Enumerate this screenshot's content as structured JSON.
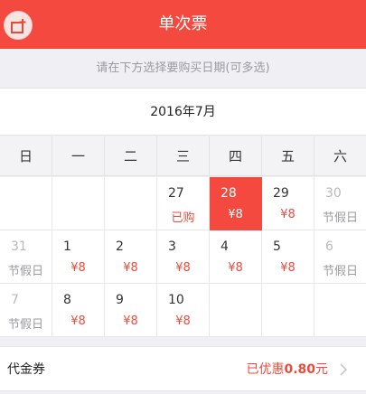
{
  "header": {
    "title": "单次票",
    "back_icon": "exit-icon"
  },
  "hint": "请在下方选择要购买日期(可多选)",
  "month_title": "2016年7月",
  "weekdays": [
    "日",
    "一",
    "二",
    "三",
    "四",
    "五",
    "六"
  ],
  "calendar": {
    "rows": [
      [
        null,
        null,
        null,
        {
          "day": "27",
          "note": "已购",
          "state": "bought"
        },
        {
          "day": "28",
          "note": "¥8",
          "state": "selected"
        },
        {
          "day": "29",
          "note": "¥8",
          "state": "available"
        },
        {
          "day": "30",
          "note": "节假日",
          "state": "holiday"
        }
      ],
      [
        {
          "day": "31",
          "note": "节假日",
          "state": "holiday"
        },
        {
          "day": "1",
          "note": "¥8",
          "state": "available"
        },
        {
          "day": "2",
          "note": "¥8",
          "state": "available"
        },
        {
          "day": "3",
          "note": "¥8",
          "state": "available"
        },
        {
          "day": "4",
          "note": "¥8",
          "state": "available"
        },
        {
          "day": "5",
          "note": "¥8",
          "state": "available"
        },
        {
          "day": "6",
          "note": "节假日",
          "state": "holiday"
        }
      ],
      [
        {
          "day": "7",
          "note": "节假日",
          "state": "holiday"
        },
        {
          "day": "8",
          "note": "¥8",
          "state": "available"
        },
        {
          "day": "9",
          "note": "¥8",
          "state": "available"
        },
        {
          "day": "10",
          "note": "¥8",
          "state": "available"
        },
        null,
        null,
        null
      ]
    ]
  },
  "coupon": {
    "label": "代金券",
    "discount_prefix": "已优惠",
    "discount_amount": "0.80",
    "discount_suffix": "元",
    "chevron_icon": "chevron-right-icon"
  },
  "colors": {
    "accent": "#f4493f",
    "price": "#ee4a3c",
    "holiday_text": "#9a9aa0"
  }
}
